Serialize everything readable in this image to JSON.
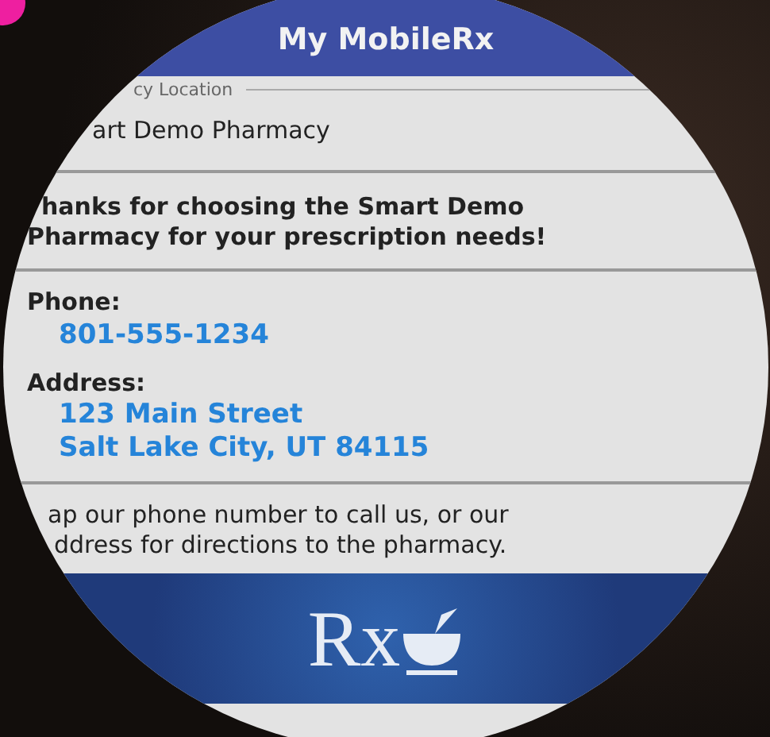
{
  "header": {
    "title": "My MobileRx"
  },
  "location": {
    "label": "cy Location",
    "value": "art Demo Pharmacy"
  },
  "intro": [
    "hanks for choosing the Smart Demo",
    "Pharmacy for your prescription needs!"
  ],
  "phone": {
    "label": "Phone:",
    "value": "801-555-1234"
  },
  "address": {
    "label": "Address:",
    "lines": [
      "123 Main Street",
      "Salt Lake City, UT 84115"
    ]
  },
  "hint": [
    "ap our phone number to call us, or our",
    "ddress for directions to the pharmacy."
  ],
  "logo": {
    "text": "Rx"
  }
}
